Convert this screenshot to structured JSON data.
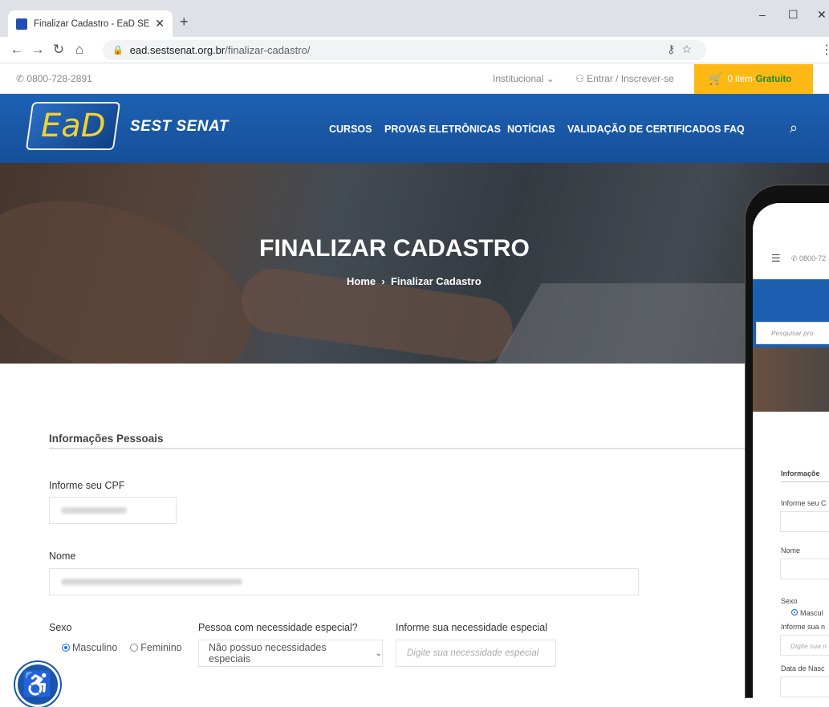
{
  "browser": {
    "tab_title": "Finalizar Cadastro - EaD SEST SE",
    "new_tab": "+",
    "url_host": "ead.sestsenat.org.br",
    "url_path": "/finalizar-cadastro/",
    "window_controls": {
      "minimize": "–",
      "maximize": "☐",
      "close": "✕"
    }
  },
  "topbar": {
    "phone": "0800-728-2891",
    "institucional": "Institucional",
    "entrar": "Entrar / Inscrever-se",
    "cart_count": "0 item",
    "cart_sep": " - ",
    "cart_free": "Gratuito"
  },
  "nav": {
    "logo_text": "EaD",
    "brand": "SEST SENAT",
    "items": [
      "CURSOS",
      "PROVAS ELETRÔNICAS",
      "NOTÍCIAS",
      "VALIDAÇÃO DE CERTIFICADOS",
      "FAQ"
    ]
  },
  "hero": {
    "title": "FINALIZAR CADASTRO",
    "crumb_home": "Home",
    "crumb_sep": "›",
    "crumb_current": "Finalizar Cadastro"
  },
  "form": {
    "section_title": "Informações Pessoais",
    "cpf_label": "Informe seu CPF",
    "nome_label": "Nome",
    "sexo_label": "Sexo",
    "sexo_options": [
      "Masculino",
      "Feminino"
    ],
    "sexo_selected": "Masculino",
    "pne_label": "Pessoa com necessidade especial?",
    "pne_value": "Não possuo necessidades especiais",
    "inf_label": "Informe sua necessidade especial",
    "inf_placeholder": "Digite sua necessidade especial"
  },
  "mobile": {
    "phone": "0800-72",
    "search_placeholder": "Pesquisar pro",
    "section_title": "Informaçõe",
    "cpf_label": "Informe seu C",
    "nome_label": "Nome",
    "sexo_label": "Sexo",
    "sexo_option": "Mascul",
    "inf_label": "Informe sua n",
    "inf_placeholder": "Digite sua n",
    "data_label": "Data de Nasc"
  },
  "colors": {
    "nav_blue": "#1d61b3",
    "cart_yellow": "#fdb813",
    "free_green": "#1d8a2d"
  }
}
